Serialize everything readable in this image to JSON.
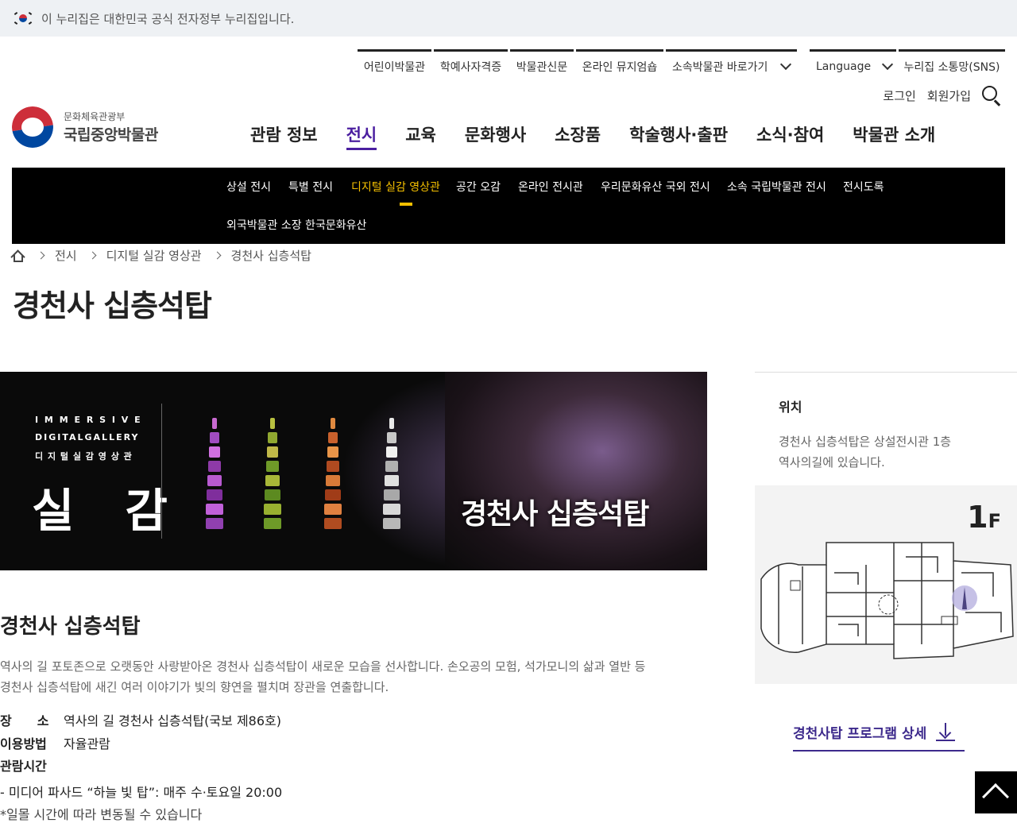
{
  "gov_banner": "이 누리집은 대한민국 공식 전자정부 누리집입니다.",
  "util_nav": [
    "어린이박물관",
    "학예사자격증",
    "박물관신문",
    "온라인 뮤지엄숍",
    "소속박물관 바로가기",
    "Language",
    "누리집 소통망(SNS)"
  ],
  "login": "로그인",
  "signup": "회원가입",
  "logo": {
    "sub": "문화체육관광부",
    "main": "국립중앙박물관"
  },
  "gnb": [
    "관람 정보",
    "전시",
    "교육",
    "문화행사",
    "소장품",
    "학술행사·출판",
    "소식·참여",
    "박물관 소개"
  ],
  "gnb_active": "전시",
  "subnav": [
    "상설 전시",
    "특별 전시",
    "디지털 실감 영상관",
    "공간 오감",
    "온라인 전시관",
    "우리문화유산 국외 전시",
    "소속 국립박물관 전시",
    "전시도록",
    "외국박물관 소장 한국문화유산"
  ],
  "subnav_active": "디지털 실감 영상관",
  "breadcrumb": [
    "전시",
    "디지털 실감 영상관",
    "경천사 십층석탑"
  ],
  "page_title": "경천사 십층석탑",
  "banner": {
    "line1": "I M M E R S I V E",
    "line2": "DIGITALGALLERY",
    "line3": "디 지 털 실 감 영 상 관",
    "big": "실 감",
    "name": "경천사 십층석탑"
  },
  "content": {
    "title": "경천사 십층석탑",
    "desc1": "역사의 길 포토존으로 오랫동안 사랑받아온 경천사 십층석탑이 새로운 모습을 선사합니다. 손오공의 모험, 석가모니의 삶과 열반 등",
    "desc2": "경천사 십층석탑에 새긴 여러 이야기가 빛의 향연을 펼치며 장관을 연출합니다.",
    "place_k": "장　　소",
    "place_v": "역사의 길 경천사 십층석탑(국보 제86호)",
    "use_k": "이용방법",
    "use_v": "자율관람",
    "time_k": "관람시간",
    "time_v1": "- 미디어 파사드 “하늘 빛 탑”: 매주 수·토요일 20:00",
    "time_v2": "*일몰 시간에 따라 변동될 수 있습니다"
  },
  "side": {
    "heading": "위치",
    "text1": "경천사 십층석탑은 상설전시관 1층",
    "text2": "역사의길에 있습니다.",
    "floor": "1",
    "floor_unit": "F",
    "program_link": "경천사탑 프로그램 상세"
  },
  "colors": {
    "accent": "#4b1fa0",
    "subnav_active": "#f5c000",
    "subnav_bg": "#000000"
  }
}
